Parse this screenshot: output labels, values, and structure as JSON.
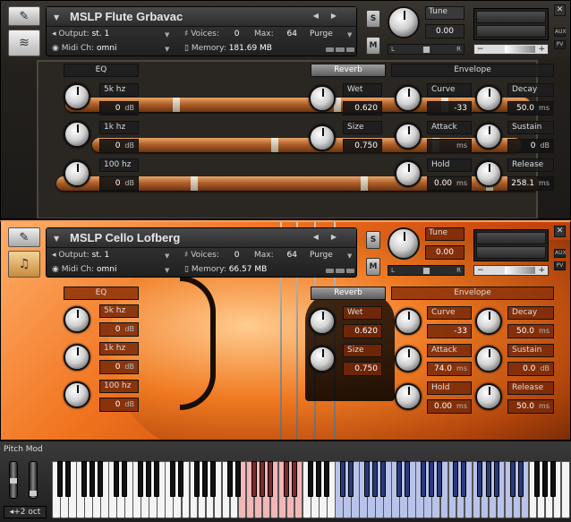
{
  "instruments": [
    {
      "name": "MSLP Flute Grbavac",
      "output_label": "Output:",
      "output": "st. 1",
      "midi_label": "Midi Ch:",
      "midi": "omni",
      "voices_label": "Voices:",
      "voices": "0",
      "max_label": "Max:",
      "max": "64",
      "memory_label": "Memory:",
      "memory": "181.69 MB",
      "purge": "Purge",
      "s": "S",
      "m": "M",
      "tune_label": "Tune",
      "tune_value": "0.00",
      "pan_l": "L",
      "pan_r": "R",
      "aux": "AUX",
      "pv": "PV",
      "eq": {
        "title": "EQ",
        "bands": [
          {
            "label": "5k hz",
            "value": "0",
            "unit": "dB"
          },
          {
            "label": "1k hz",
            "value": "0",
            "unit": "dB"
          },
          {
            "label": "100 hz",
            "value": "0",
            "unit": "dB"
          }
        ]
      },
      "reverb": {
        "title": "Reverb",
        "wet_label": "Wet",
        "wet": "0.620",
        "size_label": "Size",
        "size": "0.750"
      },
      "envelope": {
        "title": "Envelope",
        "curve_label": "Curve",
        "curve": "-33",
        "attack_label": "Attack",
        "attack": "",
        "attack_unit": "ms",
        "hold_label": "Hold",
        "hold": "0.00",
        "hold_unit": "ms",
        "decay_label": "Decay",
        "decay": "50.0",
        "decay_unit": "ms",
        "sustain_label": "Sustain",
        "sustain": "0",
        "sustain_unit": "dB",
        "release_label": "Release",
        "release": "258.1",
        "release_unit": "ms"
      }
    },
    {
      "name": "MSLP Cello Lofberg",
      "output_label": "Output:",
      "output": "st. 1",
      "midi_label": "Midi Ch:",
      "midi": "omni",
      "voices_label": "Voices:",
      "voices": "0",
      "max_label": "Max:",
      "max": "64",
      "memory_label": "Memory:",
      "memory": "66.57 MB",
      "purge": "Purge",
      "s": "S",
      "m": "M",
      "tune_label": "Tune",
      "tune_value": "0.00",
      "pan_l": "L",
      "pan_r": "R",
      "aux": "AUX",
      "pv": "PV",
      "eq": {
        "title": "EQ",
        "bands": [
          {
            "label": "5k hz",
            "value": "0",
            "unit": "dB"
          },
          {
            "label": "1k hz",
            "value": "0",
            "unit": "dB"
          },
          {
            "label": "100 hz",
            "value": "0",
            "unit": "dB"
          }
        ]
      },
      "reverb": {
        "title": "Reverb",
        "wet_label": "Wet",
        "wet": "0.620",
        "size_label": "Size",
        "size": "0.750"
      },
      "envelope": {
        "title": "Envelope",
        "curve_label": "Curve",
        "curve": "-33",
        "attack_label": "Attack",
        "attack": "74.0",
        "attack_unit": "ms",
        "hold_label": "Hold",
        "hold": "0.00",
        "hold_unit": "ms",
        "decay_label": "Decay",
        "decay": "50.0",
        "decay_unit": "ms",
        "sustain_label": "Sustain",
        "sustain": "0.0",
        "sustain_unit": "dB",
        "release_label": "Release",
        "release": "50.0",
        "release_unit": "ms"
      }
    }
  ],
  "keyboard": {
    "pitch_mod": "Pitch Mod",
    "octave": "+2 oct"
  },
  "icons": {
    "wrench": "wrench-icon",
    "flute_pic": "flute-icon",
    "guitar_pic": "guitar-icon",
    "close": "close-icon",
    "tune_knob": "knob-icon"
  },
  "colors": {
    "accent_orange": "#f0741f",
    "key_red": "#f2b6b6",
    "key_blue": "#b9c3ea"
  }
}
